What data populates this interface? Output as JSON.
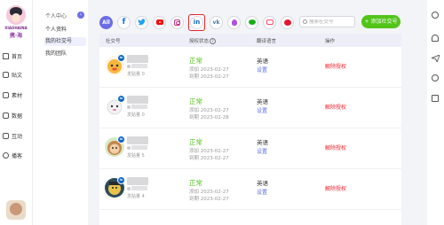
{
  "brand": {
    "name_en": "XIAOHAINA",
    "name_cn": "携·海"
  },
  "nav": {
    "items": [
      {
        "label": "首页"
      },
      {
        "label": "贴文"
      },
      {
        "label": "素材"
      },
      {
        "label": "数据"
      },
      {
        "label": "互动"
      },
      {
        "label": "播客"
      }
    ]
  },
  "subnav": {
    "section_title": "个人中心",
    "collapse_icon": "‹",
    "items": [
      {
        "label": "个人资料",
        "active": false
      },
      {
        "label": "我的社交号",
        "active": true
      },
      {
        "label": "我的团队",
        "active": false
      }
    ]
  },
  "platforms": {
    "all_label": "All",
    "icons": [
      {
        "name": "facebook-icon",
        "glyph": "f"
      },
      {
        "name": "twitter-icon",
        "glyph": "🐦"
      },
      {
        "name": "youtube-icon"
      },
      {
        "name": "instagram-icon"
      },
      {
        "name": "linkedin-icon",
        "glyph": "in",
        "selected": true
      },
      {
        "name": "vk-icon",
        "glyph": "vk"
      },
      {
        "name": "podcast-icon"
      },
      {
        "name": "wechat-icon"
      },
      {
        "name": "tv-icon"
      },
      {
        "name": "weibo-icon"
      }
    ]
  },
  "search": {
    "placeholder": "搜索社交号"
  },
  "add_button": {
    "label": "+ 添加社交号"
  },
  "table": {
    "headers": {
      "account": "社交号",
      "auth_status": "授权状态",
      "language": "翻译语言",
      "action": "操作"
    },
    "rows": [
      {
        "posts": "发贴量 0",
        "status": "正常",
        "added": "添加 2023-02-27",
        "expires": "到期 2023-02-27",
        "language": "英语",
        "settings": "设置",
        "action": "解除授权"
      },
      {
        "posts": "发贴量 0",
        "status": "正常",
        "added": "添加 2023-02-27",
        "expires": "到期 2023-02-28",
        "language": "英语",
        "settings": "设置",
        "action": "解除授权"
      },
      {
        "posts": "发贴量 5",
        "status": "正常",
        "added": "添加 2023-02-27",
        "expires": "到期 2023-02-27",
        "language": "英语",
        "settings": "设置",
        "action": "解除授权"
      },
      {
        "posts": "发贴量 4",
        "status": "正常",
        "added": "添加 2023-02-27",
        "expires": "到期 2023-02-27",
        "language": "英语",
        "settings": "设置",
        "action": "解除授权"
      }
    ]
  },
  "colors": {
    "accent": "#6c6de6",
    "success": "#52c41a",
    "danger": "#f5222d",
    "link": "#5b6ee1"
  }
}
